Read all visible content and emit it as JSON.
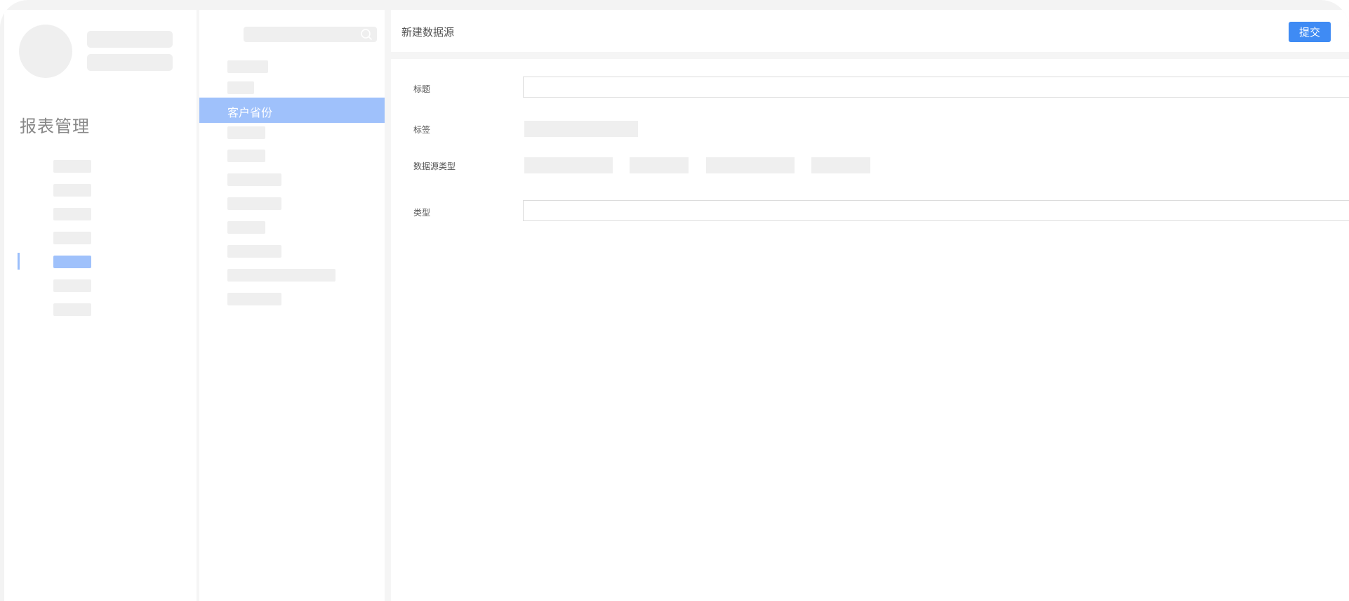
{
  "sidebar": {
    "title": "报表管理"
  },
  "list": {
    "selected_item": "客户省份"
  },
  "header": {
    "title": "新建数据源",
    "submit_label": "提交"
  },
  "form": {
    "title_label": "标题",
    "title_value": "",
    "tags_label": "标签",
    "source_type_label": "数据源类型",
    "type_label": "类型",
    "type_value": ""
  },
  "colors": {
    "accent": "#3f8bf4",
    "selected_bg": "#9fc1fb",
    "placeholder": "#efefef"
  }
}
